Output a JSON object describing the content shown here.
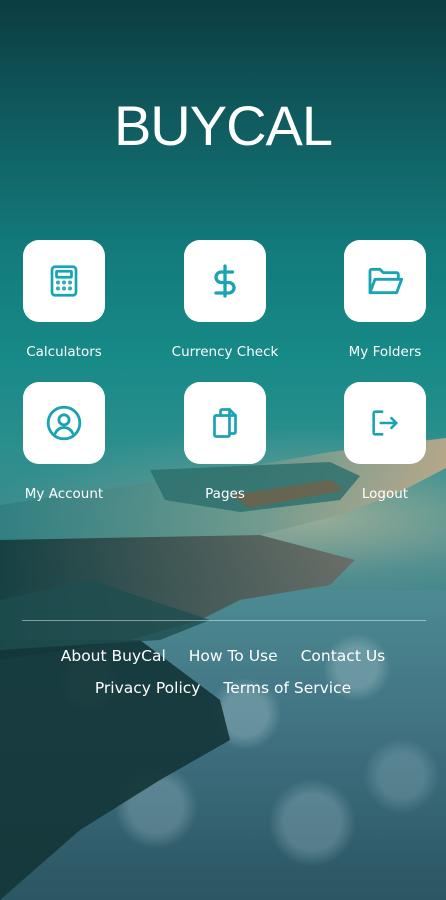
{
  "app": {
    "logo_text": "BUYCAL"
  },
  "colors": {
    "accent": "#1aa3b3",
    "tile_bg": "#ffffff",
    "text": "#ffffff"
  },
  "menu": {
    "items": [
      {
        "label": "Calculators",
        "icon": "calculator-icon"
      },
      {
        "label": "Currency Check",
        "icon": "dollar-icon"
      },
      {
        "label": "My Folders",
        "icon": "folder-open-icon"
      },
      {
        "label": "My Account",
        "icon": "user-circle-icon"
      },
      {
        "label": "Pages",
        "icon": "pages-icon"
      },
      {
        "label": "Logout",
        "icon": "logout-icon"
      }
    ]
  },
  "footer": {
    "links": [
      {
        "label": "About BuyCal"
      },
      {
        "label": "How To Use"
      },
      {
        "label": "Contact Us"
      },
      {
        "label": "Privacy Policy"
      },
      {
        "label": "Terms of Service"
      }
    ]
  }
}
